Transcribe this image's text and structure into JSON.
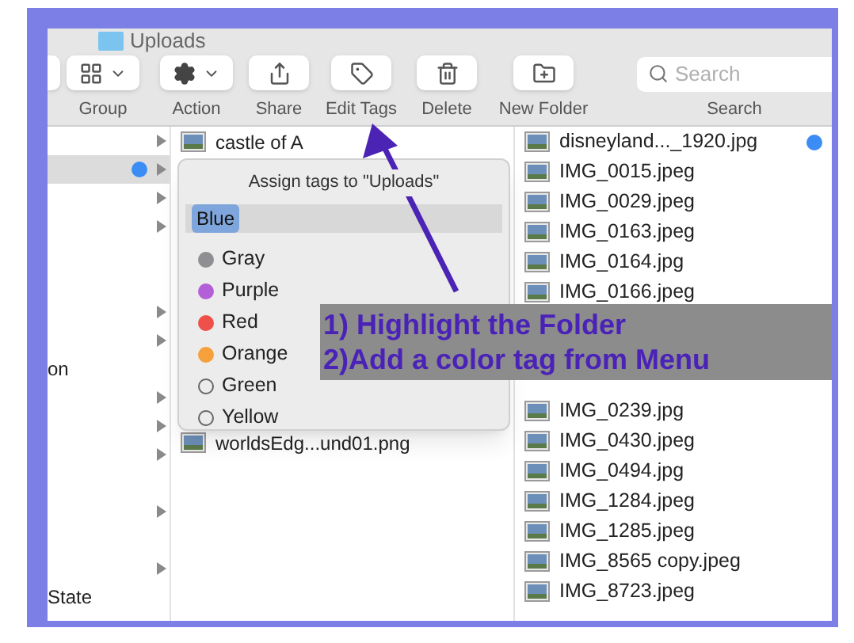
{
  "window": {
    "title": "Uploads"
  },
  "toolbar": [
    {
      "kind": "dropdown",
      "label": "Group"
    },
    {
      "kind": "dropdown",
      "label": "Action"
    },
    {
      "kind": "button",
      "label": "Share"
    },
    {
      "kind": "button",
      "label": "Edit Tags"
    },
    {
      "kind": "button",
      "label": "Delete"
    },
    {
      "kind": "button",
      "label": "New Folder"
    },
    {
      "kind": "search",
      "placeholder": "Search",
      "label": "Search"
    }
  ],
  "column_1": [
    {
      "expandable": true,
      "selected": false
    },
    {
      "expandable": true,
      "selected": true,
      "color": "#3b8cf5"
    },
    {
      "expandable": true,
      "selected": false
    },
    {
      "expandable": true,
      "selected": false
    },
    {
      "expandable": false,
      "selected": false
    },
    {
      "expandable": false,
      "selected": false
    },
    {
      "expandable": true,
      "selected": false
    },
    {
      "expandable": true,
      "selected": false
    },
    {
      "expandable": false,
      "selected": false,
      "text": "on"
    },
    {
      "expandable": true,
      "selected": false
    },
    {
      "expandable": true,
      "selected": false
    },
    {
      "expandable": true,
      "selected": false
    },
    {
      "expandable": false,
      "selected": false
    },
    {
      "expandable": true,
      "selected": false
    },
    {
      "expandable": false,
      "selected": false
    },
    {
      "expandable": true,
      "selected": false
    },
    {
      "expandable": false,
      "selected": false,
      "text": "State"
    }
  ],
  "column_2": {
    "top": "castle of A",
    "bottom": "worldsEdg...und01.png"
  },
  "column_3_top": [
    {
      "name": "disneyland..._1920.jpg",
      "color": "#3b8cf5"
    },
    {
      "name": "IMG_0015.jpeg"
    },
    {
      "name": "IMG_0029.jpeg"
    },
    {
      "name": "IMG_0163.jpeg"
    },
    {
      "name": "IMG_0164.jpg"
    },
    {
      "name": "IMG_0166.jpeg"
    }
  ],
  "column_3_bottom": [
    {
      "name": "IMG_0239.jpg"
    },
    {
      "name": "IMG_0430.jpeg"
    },
    {
      "name": "IMG_0494.jpg"
    },
    {
      "name": "IMG_1284.jpeg"
    },
    {
      "name": "IMG_1285.jpeg"
    },
    {
      "name": "IMG_8565 copy.jpeg"
    },
    {
      "name": "IMG_8723.jpeg"
    }
  ],
  "tag_popup": {
    "title": "Assign tags to \"Uploads\"",
    "tokens": [
      "Blue"
    ],
    "tags": [
      {
        "name": "Gray",
        "color": "#8e8e93"
      },
      {
        "name": "Purple",
        "color": "#b35fd8"
      },
      {
        "name": "Red",
        "color": "#f0504a"
      },
      {
        "name": "Orange",
        "color": "#f5a03a"
      },
      {
        "name": "Green"
      },
      {
        "name": "Yellow"
      }
    ]
  },
  "annotation": [
    "1) Highlight the Folder",
    "2)Add a color tag from Menu"
  ]
}
